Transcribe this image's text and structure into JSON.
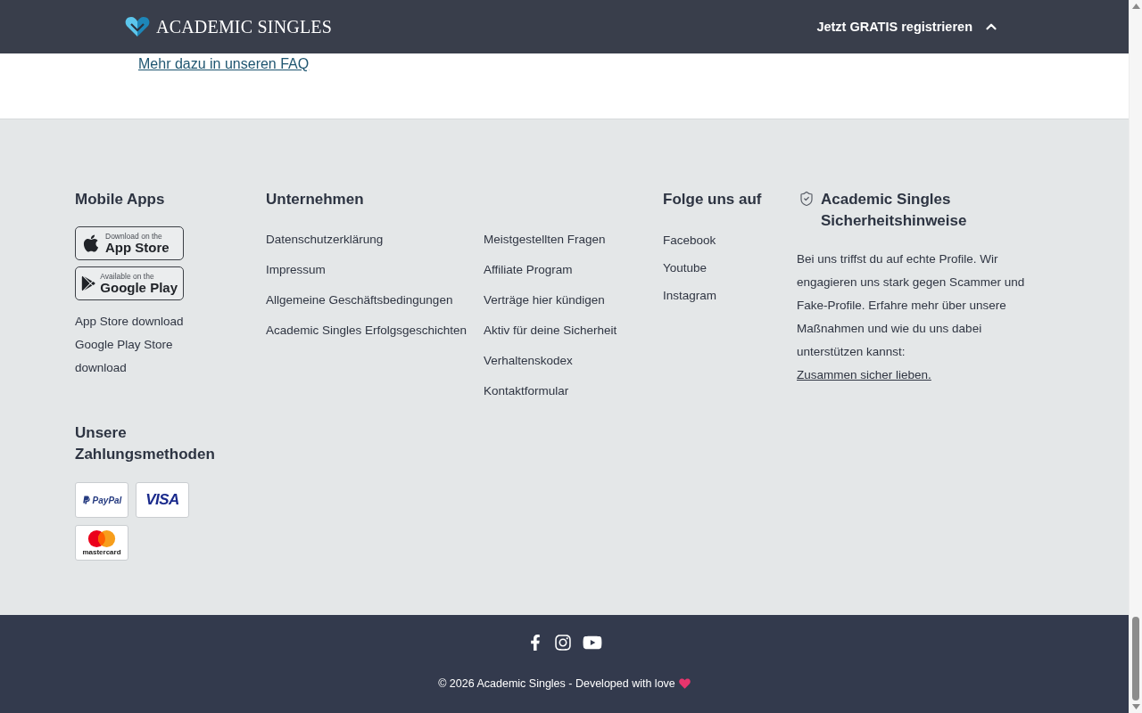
{
  "header": {
    "logo_text": "ACADEMIC SINGLES",
    "cta": "Jetzt GRATIS registrieren"
  },
  "content": {
    "faq_link": "Mehr dazu in unseren FAQ"
  },
  "footer": {
    "mobile_apps": {
      "heading": "Mobile Apps",
      "badges": [
        {
          "kind": "apple",
          "caption": "Download on the",
          "store": "App Store"
        },
        {
          "kind": "google",
          "caption": "Available on the",
          "store": "Google Play"
        }
      ],
      "links": [
        "App Store download",
        "Google Play Store download"
      ]
    },
    "payment": {
      "heading": "Unsere Zahlungsmethoden",
      "methods": [
        {
          "kind": "paypal",
          "label": "PayPal"
        },
        {
          "kind": "visa",
          "label": "VISA"
        },
        {
          "kind": "mastercard",
          "label": "mastercard"
        }
      ]
    },
    "company": {
      "heading": "Unternehmen",
      "columns": [
        [
          "Datenschutzerklärung",
          "Impressum",
          "Allgemeine Geschäftsbedingungen",
          "Academic Singles Erfolgsgeschichten"
        ],
        [
          "Meistgestellten Fragen",
          "Affiliate Program",
          "Verträge hier kündigen",
          "Aktiv für deine Sicherheit",
          "Verhaltenskodex",
          "Kontaktformular"
        ]
      ]
    },
    "social": {
      "heading": "Folge uns auf",
      "links": [
        "Facebook",
        "Youtube",
        "Instagram"
      ]
    },
    "safety": {
      "heading": "Academic Singles Sicherheitshinweise",
      "text": "Bei uns triffst du auf echte Profile. Wir engagieren uns stark gegen Scammer und Fake-Profile. Erfahre mehr über unsere Maßnahmen und wie du uns dabei unterstützen kannst:",
      "link": "Zusammen sicher lieben."
    }
  },
  "bottom_bar": {
    "social_icons": [
      {
        "kind": "facebook"
      },
      {
        "kind": "instagram"
      },
      {
        "kind": "youtube"
      }
    ],
    "copyright": "© 2026 Academic Singles - Developed with love"
  }
}
